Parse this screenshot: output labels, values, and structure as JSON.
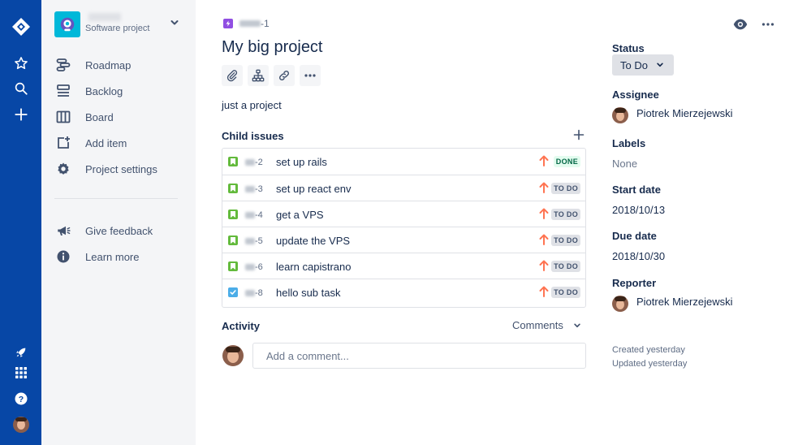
{
  "sidebar": {
    "project_type": "Software project",
    "items": [
      {
        "label": "Roadmap",
        "icon": "roadmap-icon"
      },
      {
        "label": "Backlog",
        "icon": "backlog-icon"
      },
      {
        "label": "Board",
        "icon": "board-icon"
      },
      {
        "label": "Add item",
        "icon": "add-item-icon"
      },
      {
        "label": "Project settings",
        "icon": "gear-icon"
      }
    ],
    "footer_items": [
      {
        "label": "Give feedback",
        "icon": "megaphone-icon"
      },
      {
        "label": "Learn more",
        "icon": "info-icon"
      }
    ]
  },
  "issue": {
    "breadcrumb_suffix": "-1",
    "title": "My big project",
    "description": "just a project",
    "child_issues_heading": "Child issues",
    "children": [
      {
        "key": "-2",
        "summary": "set up rails",
        "type": "story",
        "status": "DONE"
      },
      {
        "key": "-3",
        "summary": "set up react env",
        "type": "story",
        "status": "TO DO"
      },
      {
        "key": "-4",
        "summary": "get a VPS",
        "type": "story",
        "status": "TO DO"
      },
      {
        "key": "-5",
        "summary": "update the VPS",
        "type": "story",
        "status": "TO DO"
      },
      {
        "key": "-6",
        "summary": "learn capistrano",
        "type": "story",
        "status": "TO DO"
      },
      {
        "key": "-8",
        "summary": "hello sub task",
        "type": "subtask",
        "status": "TO DO"
      }
    ],
    "activity_heading": "Activity",
    "activity_filter": "Comments",
    "comment_placeholder": "Add a comment..."
  },
  "details": {
    "status_label": "Status",
    "status_value": "To Do",
    "assignee_label": "Assignee",
    "assignee": "Piotrek Mierzejewski",
    "labels_label": "Labels",
    "labels_value": "None",
    "start_label": "Start date",
    "start_value": "2018/10/13",
    "due_label": "Due date",
    "due_value": "2018/10/30",
    "reporter_label": "Reporter",
    "reporter": "Piotrek Mierzejewski",
    "created": "Created yesterday",
    "updated": "Updated yesterday"
  },
  "colors": {
    "global_nav": "#0747A6",
    "sidebar_bg": "#F4F5F7",
    "story": "#63BA3C",
    "subtask": "#4BADE8",
    "epic": "#904EE2",
    "priority_high": "#FF7452",
    "done_bg": "#E3FCEF",
    "done_text": "#006644"
  }
}
